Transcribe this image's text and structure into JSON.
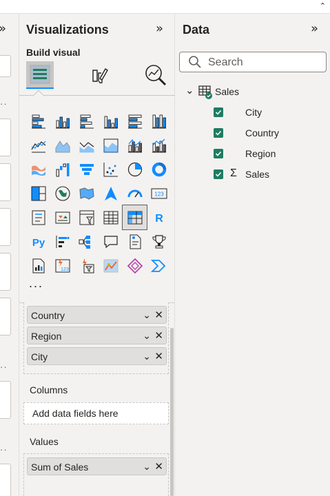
{
  "ribbon": {
    "collapse_icon": "chevron-up-icon"
  },
  "visualizations": {
    "title": "Visualizations",
    "expand_icon": "double-chevron-right-icon",
    "build_label": "Build visual",
    "tabs": [
      {
        "name": "build-visual",
        "icon": "build-visual-icon",
        "selected": true
      },
      {
        "name": "format-visual",
        "icon": "paintbrush-icon",
        "selected": false
      },
      {
        "name": "analytics",
        "icon": "magnifier-chart-icon",
        "selected": false
      }
    ],
    "visuals": [
      "stacked-bar-chart-icon",
      "stacked-column-chart-icon",
      "clustered-bar-chart-icon",
      "clustered-column-chart-icon",
      "100-percent-stacked-bar-icon",
      "100-percent-stacked-column-icon",
      "line-chart-icon",
      "area-chart-icon",
      "stacked-area-chart-icon",
      "100-percent-stacked-area-icon",
      "line-and-stacked-column-icon",
      "line-and-clustered-column-icon",
      "ribbon-chart-icon",
      "waterfall-chart-icon",
      "funnel-chart-icon",
      "scatter-chart-icon",
      "pie-chart-icon",
      "donut-chart-icon",
      "treemap-icon",
      "map-icon",
      "filled-map-icon",
      "azure-map-icon",
      "gauge-icon",
      "card-icon",
      "multi-row-card-icon",
      "kpi-icon",
      "slicer-icon",
      "table-icon",
      "matrix-icon",
      "r-visual-icon",
      "python-visual-icon",
      "key-influencers-icon",
      "decomposition-tree-icon",
      "qa-icon",
      "smart-narrative-icon",
      "metrics-icon",
      "paginated-report-icon",
      "power-apps-icon",
      "power-automate-icon",
      "arcgis-map-icon",
      "power-apps-diamond-icon",
      "power-automate-chevron-icon"
    ],
    "selected_visual_index": 28,
    "r_label": "R",
    "py_label": "Py",
    "card_number": "123",
    "more_label": "...",
    "rows_well": [
      {
        "label": "Country"
      },
      {
        "label": "Region"
      },
      {
        "label": "City"
      }
    ],
    "columns_header": "Columns",
    "columns_placeholder": "Add data fields here",
    "values_header": "Values",
    "values_well": [
      {
        "label": "Sum of Sales"
      }
    ],
    "chip_expand_icon": "chevron-down-icon",
    "chip_remove_icon": "close-icon"
  },
  "data_pane": {
    "title": "Data",
    "expand_icon": "double-chevron-right-icon",
    "search_placeholder": "Search",
    "table": {
      "name": "Sales",
      "icon": "table-icon",
      "expanded": true
    },
    "fields": [
      {
        "label": "City",
        "checked": true,
        "measure": false
      },
      {
        "label": "Country",
        "checked": true,
        "measure": false
      },
      {
        "label": "Region",
        "checked": true,
        "measure": false
      },
      {
        "label": "Sales",
        "checked": true,
        "measure": true
      }
    ],
    "sigma": "Σ"
  },
  "colors": {
    "accent": "#118dff",
    "check": "#1f7c61",
    "pane_bg": "#f3f2f1",
    "chip_bg": "#e1dfdd"
  }
}
